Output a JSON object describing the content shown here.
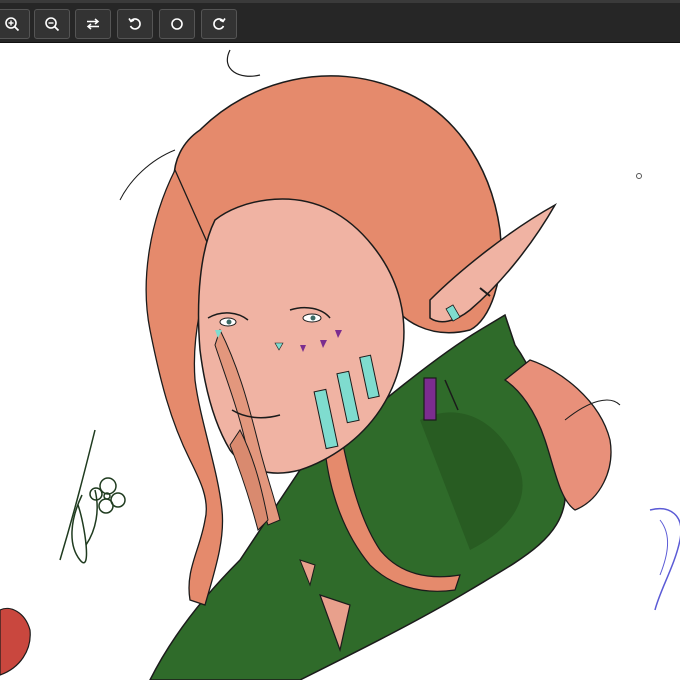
{
  "toolbar": {
    "buttons": [
      {
        "name": "zoom-in",
        "icon": "zoom-in-icon"
      },
      {
        "name": "zoom-out",
        "icon": "zoom-out-icon"
      },
      {
        "name": "swap",
        "icon": "swap-horizontal-icon"
      },
      {
        "name": "rotate-left",
        "icon": "rotate-left-icon"
      },
      {
        "name": "reset",
        "icon": "circle-icon"
      },
      {
        "name": "rotate-right",
        "icon": "rotate-right-icon"
      }
    ]
  },
  "canvas": {
    "image": "digital-sketch-elf-character-illustration",
    "colors": {
      "hair": "#e58a6c",
      "skin": "#f0b3a3",
      "cloak": "#2f6b2a",
      "accent_teal": "#7fdccf",
      "accent_purple": "#7b2d8f"
    }
  }
}
